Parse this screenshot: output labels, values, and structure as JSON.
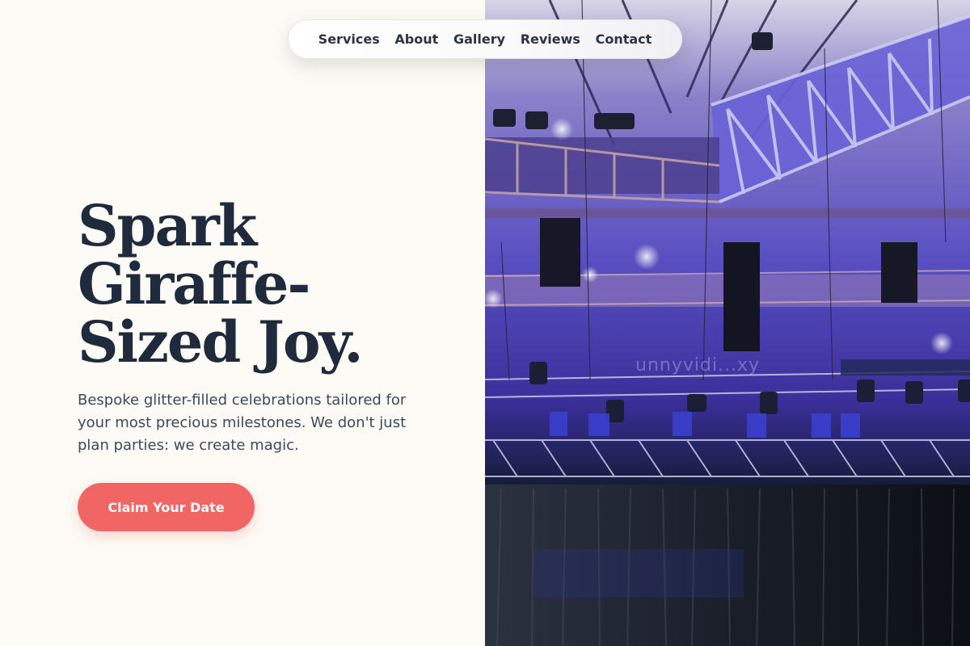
{
  "nav": {
    "items": [
      {
        "label": "Services"
      },
      {
        "label": "About"
      },
      {
        "label": "Gallery"
      },
      {
        "label": "Reviews"
      },
      {
        "label": "Contact"
      }
    ]
  },
  "hero": {
    "title_lines": [
      "Spark",
      "Giraffe-",
      "Sized Joy."
    ],
    "description": "Bespoke glitter-filled celebrations tailored for your most precious milestones. We don't just plan parties: we create magic.",
    "cta_label": "Claim Your Date"
  },
  "image": {
    "watermark": "unnyvidi...xy",
    "subject": "concert-stage-rigging-photo"
  },
  "colors": {
    "background": "#fcfbf5",
    "heading": "#1f2a3d",
    "body_text": "#3f4858",
    "accent": "#f26565",
    "nav_text": "#2b3445"
  }
}
